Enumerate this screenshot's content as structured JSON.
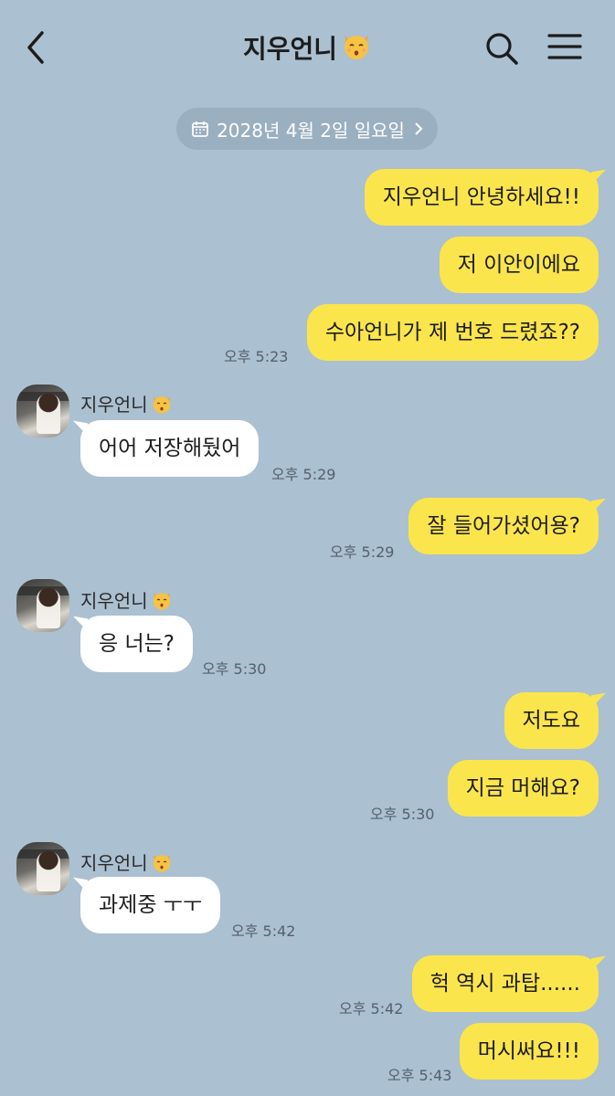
{
  "header": {
    "title": "지우언니",
    "title_emoji": "kissing-cat-emoji",
    "icons": [
      "back-chevron-icon",
      "search-icon",
      "menu-icon"
    ]
  },
  "date_divider": {
    "label": "2028년 4월 2일 일요일",
    "icon": "calendar-icon"
  },
  "colors": {
    "background": "#abc0d1",
    "my_bubble": "#fbe54d",
    "their_bubble": "#ffffff",
    "time_text": "#55606b"
  },
  "messages": [
    {
      "from": "me",
      "text": "지우언니 안녕하세요!!"
    },
    {
      "from": "me",
      "text": "저 이안이에요"
    },
    {
      "from": "me",
      "text": "수아언니가 제 번호 드렸죠??",
      "time": "오후 5:23"
    },
    {
      "from": "them",
      "sender": "지우언니",
      "text": "어어 저장해뒀어",
      "time": "오후 5:29"
    },
    {
      "from": "me",
      "text": "잘 들어가셨어용?",
      "time": "오후 5:29"
    },
    {
      "from": "them",
      "sender": "지우언니",
      "text": "응 너는?",
      "time": "오후 5:30"
    },
    {
      "from": "me",
      "text": "저도요"
    },
    {
      "from": "me",
      "text": "지금 머해요?",
      "time": "오후 5:30"
    },
    {
      "from": "them",
      "sender": "지우언니",
      "text": "과제중 ㅜㅜ",
      "time": "오후 5:42"
    },
    {
      "from": "me",
      "text": "헉 역시 과탑......",
      "time": "오후 5:42"
    },
    {
      "from": "me",
      "text": "머시써요!!!",
      "time": "오후 5:43"
    }
  ]
}
